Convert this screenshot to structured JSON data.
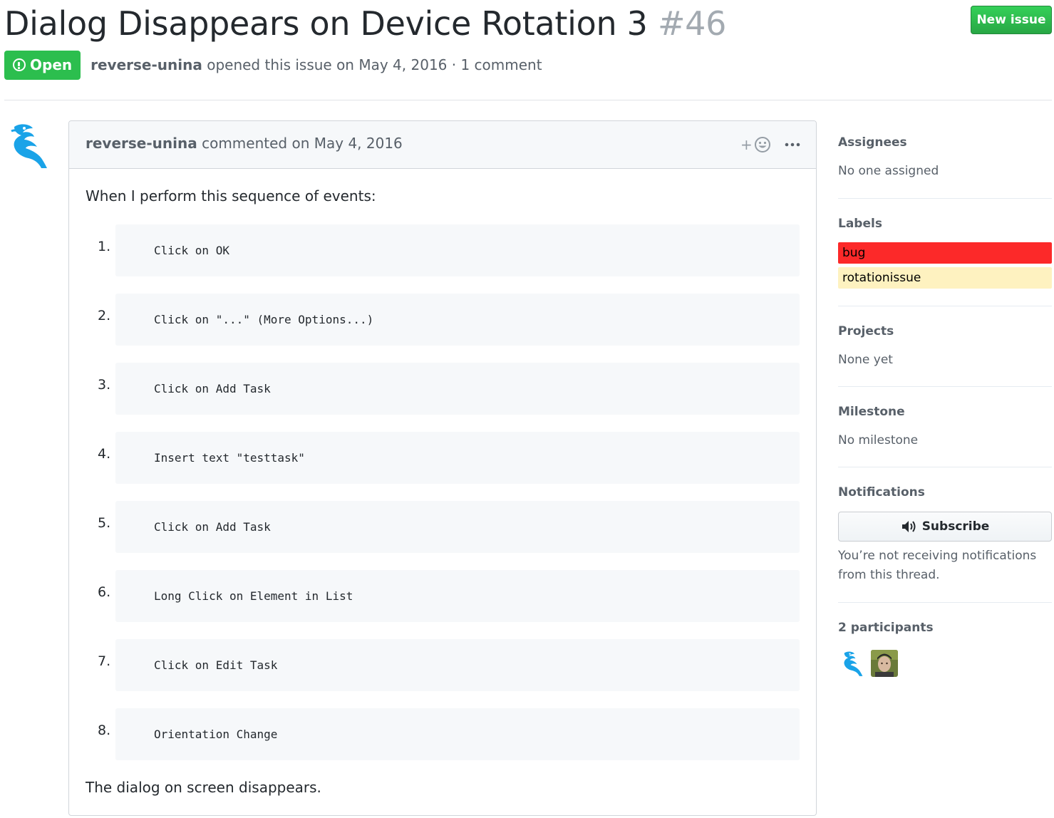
{
  "issue": {
    "title": "Dialog Disappears on Device Rotation 3",
    "number": "#46",
    "new_issue_label": "New issue",
    "state": "Open",
    "author": "reverse-unina",
    "meta_rest": "opened this issue on May 4, 2016 · 1 comment"
  },
  "comment": {
    "author": "reverse-unina",
    "header_rest": "commented on May 4, 2016",
    "reaction_plus": "+",
    "intro": "When I perform this sequence of events:",
    "steps": [
      {
        "num": "1.",
        "code": "Click on OK"
      },
      {
        "num": "2.",
        "code": "Click on \"...\" (More Options...)"
      },
      {
        "num": "3.",
        "code": "Click on Add Task"
      },
      {
        "num": "4.",
        "code": "Insert text \"testtask\""
      },
      {
        "num": "5.",
        "code": "Click on Add Task"
      },
      {
        "num": "6.",
        "code": "Long Click on Element in List"
      },
      {
        "num": "7.",
        "code": "Click on Edit Task"
      },
      {
        "num": "8.",
        "code": "Orientation Change"
      }
    ],
    "outro": "The dialog on screen disappears."
  },
  "sidebar": {
    "assignees": {
      "heading": "Assignees",
      "value": "No one assigned"
    },
    "labels": {
      "heading": "Labels",
      "items": [
        {
          "name": "bug",
          "color": "#fc2929",
          "text_color": "#000000"
        },
        {
          "name": "rotationissue",
          "color": "#fef2c0",
          "text_color": "#000000"
        }
      ]
    },
    "projects": {
      "heading": "Projects",
      "value": "None yet"
    },
    "milestone": {
      "heading": "Milestone",
      "value": "No milestone"
    },
    "notifications": {
      "heading": "Notifications",
      "subscribe_label": "Subscribe",
      "line1": "You’re not receiving notifications",
      "line2": "from this thread."
    },
    "participants": {
      "heading": "2 participants"
    }
  },
  "colors": {
    "open_green": "#2cbe4e",
    "new_issue_green": "#28a745",
    "avatar_blue": "#1aa3e8"
  }
}
